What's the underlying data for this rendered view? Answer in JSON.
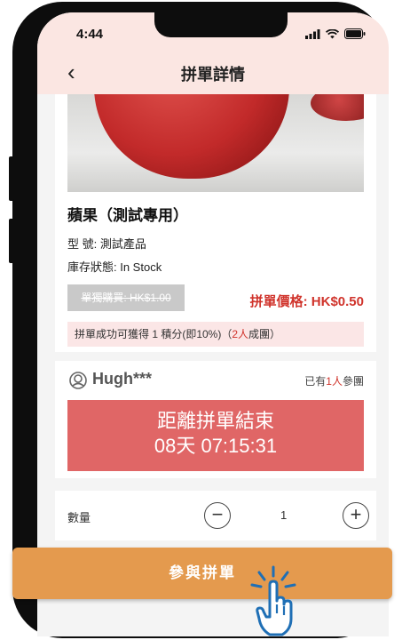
{
  "status": {
    "time": "4:44"
  },
  "header": {
    "back_glyph": "‹",
    "title": "拼單詳情"
  },
  "product": {
    "name": "蘋果（測試專用）",
    "model_label": "型  號: 測試產品",
    "stock_label": "庫存狀態: In Stock",
    "original_price": "單獨購買: HK$1.00",
    "group_price": "拼單價格: HK$0.50",
    "points_prefix": "拼單成功可獲得 1 積分(即10%)（",
    "points_highlight": "2人",
    "points_suffix": "成團）"
  },
  "group": {
    "host_name": "Hugh***",
    "joined_prefix": "已有",
    "joined_count": "1人",
    "joined_suffix": "參團",
    "countdown_label": "距離拼單結束",
    "countdown_time": "08天 07:15:31"
  },
  "quantity": {
    "label": "數量",
    "value": "1",
    "minus": "−",
    "plus": "+"
  },
  "action": {
    "join_label": "參與拼單"
  },
  "colors": {
    "accent": "#d0342c",
    "header_bg": "#fbe6e2",
    "countdown_bg": "#e06666",
    "button_bg": "#e49a4e"
  },
  "icons": [
    "back-chevron-icon",
    "signal-icon",
    "wifi-icon",
    "battery-icon",
    "user-avatar-icon",
    "minus-icon",
    "plus-icon",
    "hand-pointer-icon"
  ]
}
